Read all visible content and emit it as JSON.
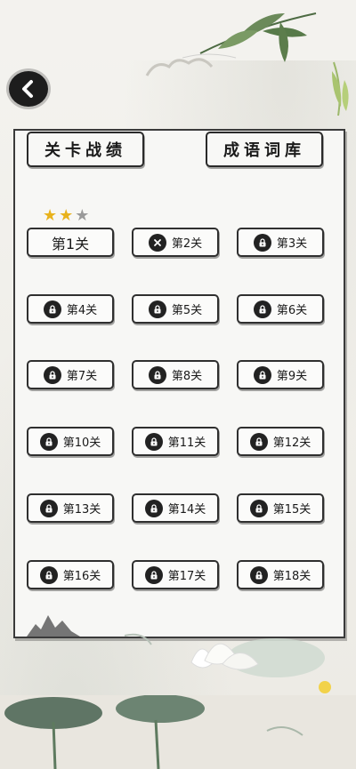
{
  "header": {
    "back_icon": "chevron-left-icon"
  },
  "tabs": {
    "record_label": "关卡战绩",
    "idiom_label": "成语词库"
  },
  "level_1_stars": {
    "earned": 2,
    "total": 3
  },
  "levels": [
    {
      "label": "第1关",
      "state": "unlocked"
    },
    {
      "label": "第2关",
      "state": "failed",
      "icon": "close-icon"
    },
    {
      "label": "第3关",
      "state": "locked",
      "icon": "lock-icon"
    },
    {
      "label": "第4关",
      "state": "locked",
      "icon": "lock-icon"
    },
    {
      "label": "第5关",
      "state": "locked",
      "icon": "lock-icon"
    },
    {
      "label": "第6关",
      "state": "locked",
      "icon": "lock-icon"
    },
    {
      "label": "第7关",
      "state": "locked",
      "icon": "lock-icon"
    },
    {
      "label": "第8关",
      "state": "locked",
      "icon": "lock-icon"
    },
    {
      "label": "第9关",
      "state": "locked",
      "icon": "lock-icon"
    },
    {
      "label": "第10关",
      "state": "locked",
      "icon": "lock-icon"
    },
    {
      "label": "第11关",
      "state": "locked",
      "icon": "lock-icon"
    },
    {
      "label": "第12关",
      "state": "locked",
      "icon": "lock-icon"
    },
    {
      "label": "第13关",
      "state": "locked",
      "icon": "lock-icon"
    },
    {
      "label": "第14关",
      "state": "locked",
      "icon": "lock-icon"
    },
    {
      "label": "第15关",
      "state": "locked",
      "icon": "lock-icon"
    },
    {
      "label": "第16关",
      "state": "locked",
      "icon": "lock-icon"
    },
    {
      "label": "第17关",
      "state": "locked",
      "icon": "lock-icon"
    },
    {
      "label": "第18关",
      "state": "locked",
      "icon": "lock-icon"
    }
  ],
  "colors": {
    "ink": "#1a1a1a",
    "star_gold": "#e8b21c",
    "star_grey": "#9a9a9a",
    "panel": "#f7f7f5"
  }
}
